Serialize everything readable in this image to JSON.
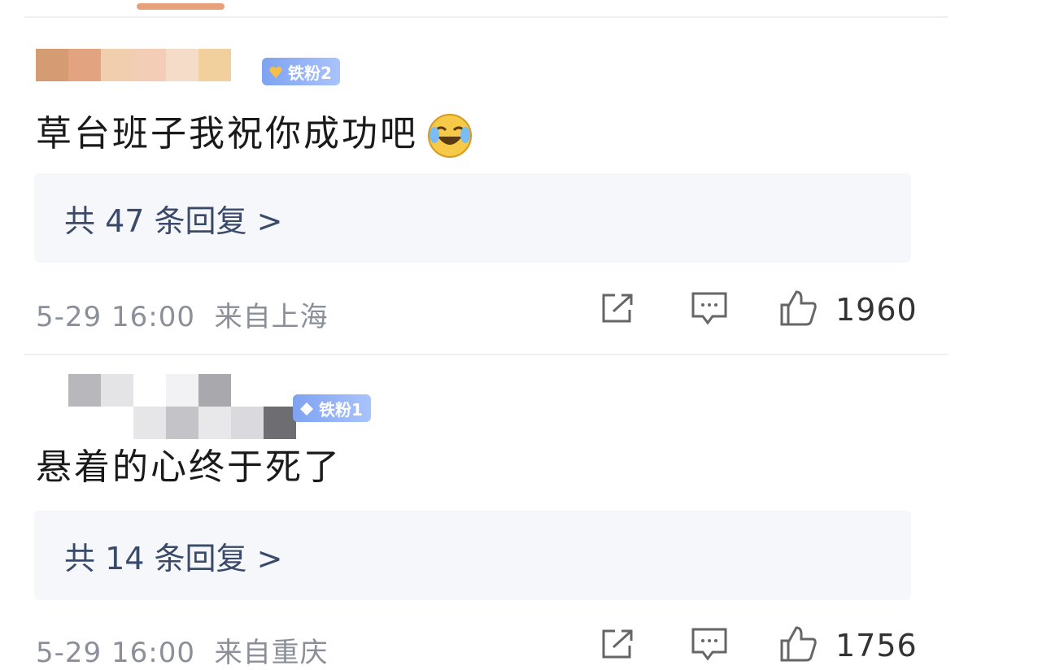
{
  "comments": [
    {
      "badge": "铁粉2",
      "text": "草台班子我祝你成功吧",
      "emoji": "laugh-cry-emoji",
      "replies": "共 47 条回复 >",
      "time": "5-29 16:00",
      "location": "来自上海",
      "likes": "1960"
    },
    {
      "badge": "铁粉1",
      "text": "悬着的心终于死了",
      "replies": "共 14 条回复 >",
      "time": "5-29 16:00",
      "location": "来自重庆",
      "likes": "1756"
    }
  ],
  "colors": {
    "badge": "#8aaef5",
    "reply_box_bg": "#f6f7fa",
    "reply_text": "#3a4a6a",
    "meta_text": "#8a8f99"
  },
  "icons": [
    "share-icon",
    "comment-icon",
    "thumbs-up-icon",
    "badge-heart-icon",
    "badge-diamond-icon",
    "laugh-cry-emoji"
  ]
}
